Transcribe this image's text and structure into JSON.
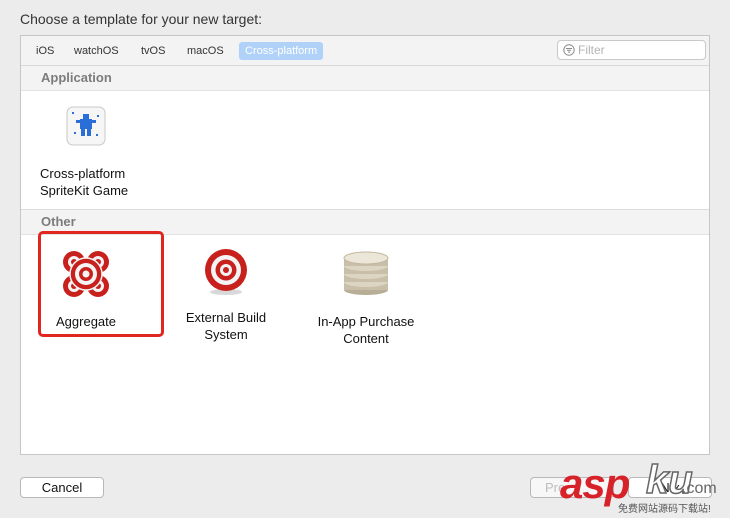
{
  "dialog": {
    "title": "Choose a template for your new target:"
  },
  "platform_tabs": [
    {
      "label": "iOS",
      "selected": false
    },
    {
      "label": "watchOS",
      "selected": false
    },
    {
      "label": "tvOS",
      "selected": false
    },
    {
      "label": "macOS",
      "selected": false
    },
    {
      "label": "Cross-platform",
      "selected": true
    }
  ],
  "filter": {
    "value": "",
    "placeholder": "Filter",
    "icon": "filter-icon"
  },
  "sections": {
    "application": {
      "header": "Application",
      "templates": [
        {
          "line1": "Cross-platform",
          "line2": "SpriteKit Game",
          "icon": "spritekit-game-icon"
        }
      ]
    },
    "other": {
      "header": "Other",
      "templates": [
        {
          "line1": "Aggregate",
          "line2": "",
          "icon": "aggregate-target-icon",
          "highlighted": true
        },
        {
          "line1": "External Build",
          "line2": "System",
          "icon": "target-icon"
        },
        {
          "line1": "In-App Purchase",
          "line2": "Content",
          "icon": "coin-stack-icon"
        }
      ]
    }
  },
  "footer": {
    "cancel": "Cancel",
    "previous": "Pre",
    "next": "N x"
  },
  "watermark": {
    "brand_a": "asp",
    "brand_b": "ku",
    "suffix": ".com",
    "tagline": "免费网站源码下载站!"
  },
  "colors": {
    "selected_tab": "#b0d2f8",
    "highlight": "#e0261f",
    "target_red": "#c8201c"
  }
}
